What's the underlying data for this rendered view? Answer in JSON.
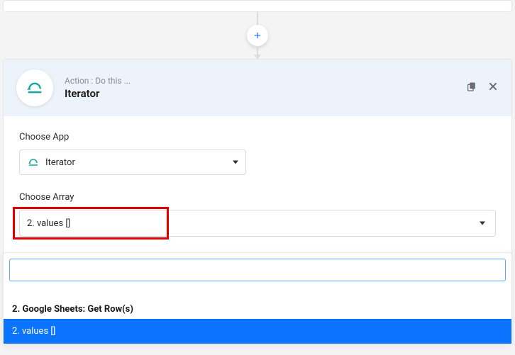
{
  "header": {
    "subtitle": "Action : Do this ...",
    "title": "Iterator"
  },
  "chooseApp": {
    "label": "Choose App",
    "selected": "Iterator"
  },
  "chooseArray": {
    "label": "Choose Array",
    "selected": "2. values []"
  },
  "dropdown": {
    "search_value": "",
    "group_header": "2. Google Sheets: Get Row(s)",
    "item_selected": "2. values []"
  }
}
